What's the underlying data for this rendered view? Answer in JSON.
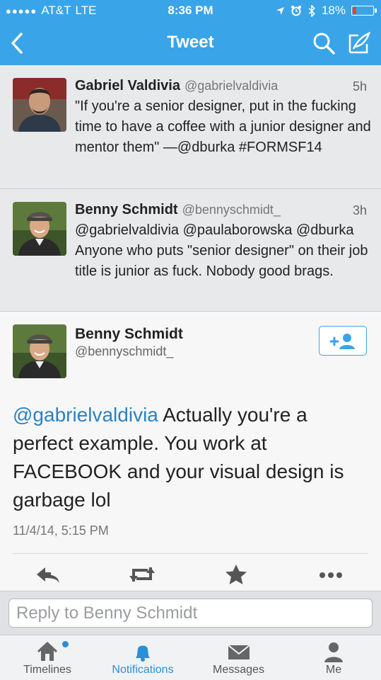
{
  "status_bar": {
    "carrier": "AT&T",
    "network": "LTE",
    "time": "8:36 PM",
    "battery_percent": "18%",
    "battery_level": 0.18,
    "battery_color": "#ff3b30",
    "icons": [
      "location-arrow-icon",
      "alarm-icon",
      "bluetooth-icon",
      "battery-icon"
    ]
  },
  "nav": {
    "title": "Tweet",
    "back_icon": "chevron-left-icon",
    "search_icon": "search-icon",
    "compose_icon": "compose-icon",
    "bar_color": "#3aa4e8"
  },
  "tweets": [
    {
      "name": "Gabriel Valdivia",
      "handle": "@gabrielvaldivia",
      "time": "5h",
      "text": "\"If you're a senior designer, put in the fucking time to have a coffee with a junior designer and mentor them\" —@dburka #FORMSF14"
    },
    {
      "name": "Benny Schmidt",
      "handle": "@bennyschmidt_",
      "time": "3h",
      "text": "@gabrielvaldivia @paulaborowska @dburka Anyone who puts \"senior designer\" on their job title is junior as fuck. Nobody good brags."
    }
  ],
  "detail": {
    "name": "Benny Schmidt",
    "handle": "@bennyschmidt_",
    "follow_icon": "add-user-icon",
    "mention": "@gabrielvaldivia",
    "text": " Actually you're a perfect example. You work at FACEBOOK and your visual design is garbage lol",
    "timestamp": "11/4/14, 5:15 PM",
    "actions": [
      "reply-icon",
      "retweet-icon",
      "favorite-icon",
      "more-icon"
    ]
  },
  "reply": {
    "placeholder": "Reply to Benny Schmidt"
  },
  "tabs": [
    {
      "label": "Timelines",
      "icon": "home-icon",
      "active": false,
      "unread": true
    },
    {
      "label": "Notifications",
      "icon": "bell-icon",
      "active": true,
      "unread": false
    },
    {
      "label": "Messages",
      "icon": "envelope-icon",
      "active": false,
      "unread": false
    },
    {
      "label": "Me",
      "icon": "person-icon",
      "active": false,
      "unread": false
    }
  ],
  "colors": {
    "accent": "#3aa4e8",
    "active_tab": "#2a8fd8",
    "mention": "#2a82c4"
  }
}
